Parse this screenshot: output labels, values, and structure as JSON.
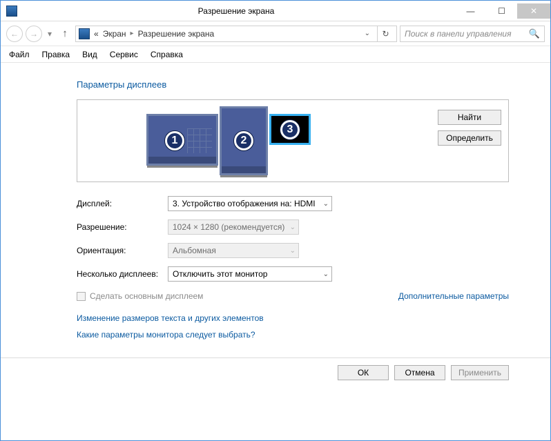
{
  "window": {
    "title": "Разрешение экрана",
    "minimize_glyph": "—",
    "maximize_glyph": "☐",
    "close_glyph": "✕"
  },
  "nav": {
    "back_glyph": "←",
    "fwd_glyph": "→",
    "dropdown_glyph": "▾",
    "up_glyph": "↑",
    "refresh_glyph": "↻",
    "crumb_prefix": "«",
    "crumb1": "Экран",
    "crumb_sep": "▸",
    "crumb2": "Разрешение экрана",
    "addr_drop": "⌄",
    "search_placeholder": "Поиск в панели управления",
    "search_icon": "🔍"
  },
  "menu": {
    "file": "Файл",
    "edit": "Правка",
    "view": "Вид",
    "tools": "Сервис",
    "help": "Справка"
  },
  "heading": "Параметры дисплеев",
  "monitors": {
    "m1": "1",
    "m2": "2",
    "m3": "3",
    "find": "Найти",
    "identify": "Определить"
  },
  "form": {
    "display_label": "Дисплей:",
    "display_value": "3. Устройство отображения на: HDMI",
    "resolution_label": "Разрешение:",
    "resolution_value": "1024 × 1280 (рекомендуется)",
    "orientation_label": "Ориентация:",
    "orientation_value": "Альбомная",
    "multi_label": "Несколько дисплеев:",
    "multi_value": "Отключить этот монитор",
    "make_primary": "Сделать основным дисплеем",
    "advanced": "Дополнительные параметры"
  },
  "links": {
    "scale": "Изменение размеров текста и других элементов",
    "which": "Какие параметры монитора следует выбрать?"
  },
  "buttons": {
    "ok": "ОК",
    "cancel": "Отмена",
    "apply": "Применить"
  },
  "glyphs": {
    "dd": "⌄"
  }
}
